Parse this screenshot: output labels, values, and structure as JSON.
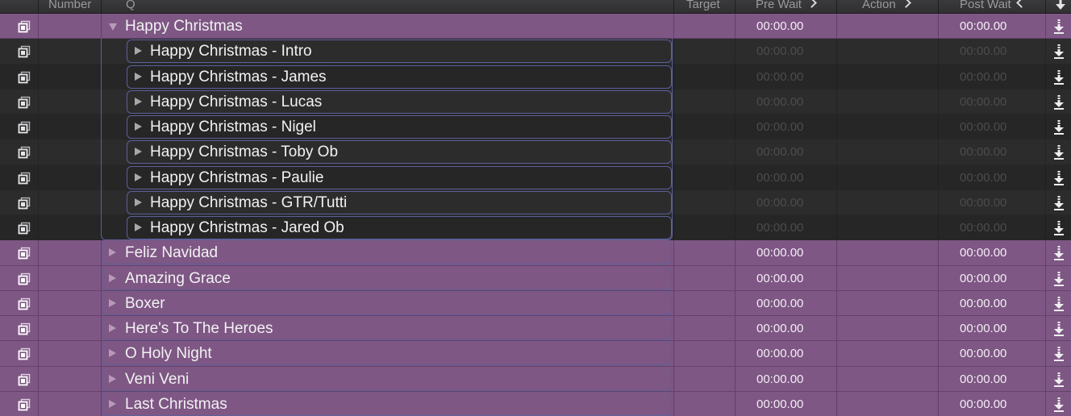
{
  "header": {
    "number": "Number",
    "q": "Q",
    "target": "Target",
    "pre_wait": "Pre Wait",
    "action": "Action",
    "post_wait": "Post Wait"
  },
  "icons": {
    "cue_type": "group-cue-icon",
    "continue": "auto-continue-arrow-icon",
    "disclosure_open": "triangle-down-icon",
    "disclosure_closed": "triangle-right-icon"
  },
  "colors": {
    "group_row": "#7e5784",
    "cue_border": "#5d5f9a",
    "child_row_odd": "#2c2c2d",
    "child_row_even": "#262627"
  },
  "rows": [
    {
      "level": 0,
      "expanded": true,
      "name": "Happy Christmas",
      "pre_wait": "00:00.00",
      "post_wait": "00:00.00"
    },
    {
      "level": 1,
      "expanded": false,
      "name": "Happy Christmas - Intro",
      "pre_wait": "00:00.00",
      "post_wait": "00:00.00"
    },
    {
      "level": 1,
      "expanded": false,
      "name": "Happy Christmas - James",
      "pre_wait": "00:00.00",
      "post_wait": "00:00.00"
    },
    {
      "level": 1,
      "expanded": false,
      "name": "Happy Christmas - Lucas",
      "pre_wait": "00:00.00",
      "post_wait": "00:00.00"
    },
    {
      "level": 1,
      "expanded": false,
      "name": "Happy Christmas - Nigel",
      "pre_wait": "00:00.00",
      "post_wait": "00:00.00"
    },
    {
      "level": 1,
      "expanded": false,
      "name": "Happy Christmas - Toby Ob",
      "pre_wait": "00:00.00",
      "post_wait": "00:00.00"
    },
    {
      "level": 1,
      "expanded": false,
      "name": "Happy Christmas - Paulie",
      "pre_wait": "00:00.00",
      "post_wait": "00:00.00"
    },
    {
      "level": 1,
      "expanded": false,
      "name": "Happy Christmas - GTR/Tutti",
      "pre_wait": "00:00.00",
      "post_wait": "00:00.00"
    },
    {
      "level": 1,
      "expanded": false,
      "name": "Happy Christmas - Jared Ob",
      "pre_wait": "00:00.00",
      "post_wait": "00:00.00"
    },
    {
      "level": 0,
      "expanded": false,
      "name": "Feliz Navidad",
      "pre_wait": "00:00.00",
      "post_wait": "00:00.00"
    },
    {
      "level": 0,
      "expanded": false,
      "name": "Amazing Grace",
      "pre_wait": "00:00.00",
      "post_wait": "00:00.00"
    },
    {
      "level": 0,
      "expanded": false,
      "name": "Boxer",
      "pre_wait": "00:00.00",
      "post_wait": "00:00.00"
    },
    {
      "level": 0,
      "expanded": false,
      "name": "Here's To The Heroes",
      "pre_wait": "00:00.00",
      "post_wait": "00:00.00"
    },
    {
      "level": 0,
      "expanded": false,
      "name": "O Holy Night",
      "pre_wait": "00:00.00",
      "post_wait": "00:00.00"
    },
    {
      "level": 0,
      "expanded": false,
      "name": "Veni Veni",
      "pre_wait": "00:00.00",
      "post_wait": "00:00.00"
    },
    {
      "level": 0,
      "expanded": false,
      "name": "Last Christmas",
      "pre_wait": "00:00.00",
      "post_wait": "00:00.00"
    }
  ]
}
